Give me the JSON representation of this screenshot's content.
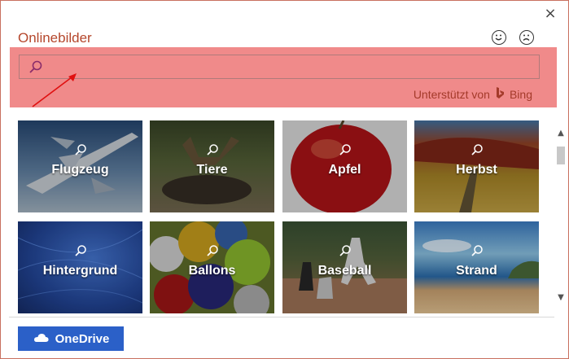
{
  "dialog": {
    "title": "Onlinebilder",
    "close_icon": "×",
    "feedback": {
      "happy_icon": "smile-icon",
      "sad_icon": "frown-icon"
    }
  },
  "search": {
    "value": "",
    "placeholder": "",
    "powered_by": "Unterstützt von",
    "provider": "Bing",
    "highlight_color": "#f08a8a"
  },
  "categories": [
    {
      "label": "Flugzeug"
    },
    {
      "label": "Tiere"
    },
    {
      "label": "Apfel"
    },
    {
      "label": "Herbst"
    },
    {
      "label": "Hintergrund"
    },
    {
      "label": "Ballons"
    },
    {
      "label": "Baseball"
    },
    {
      "label": "Strand"
    }
  ],
  "footer": {
    "onedrive_label": "OneDrive"
  },
  "colors": {
    "accent": "#b5472c",
    "onedrive_blue": "#2b60c8"
  }
}
